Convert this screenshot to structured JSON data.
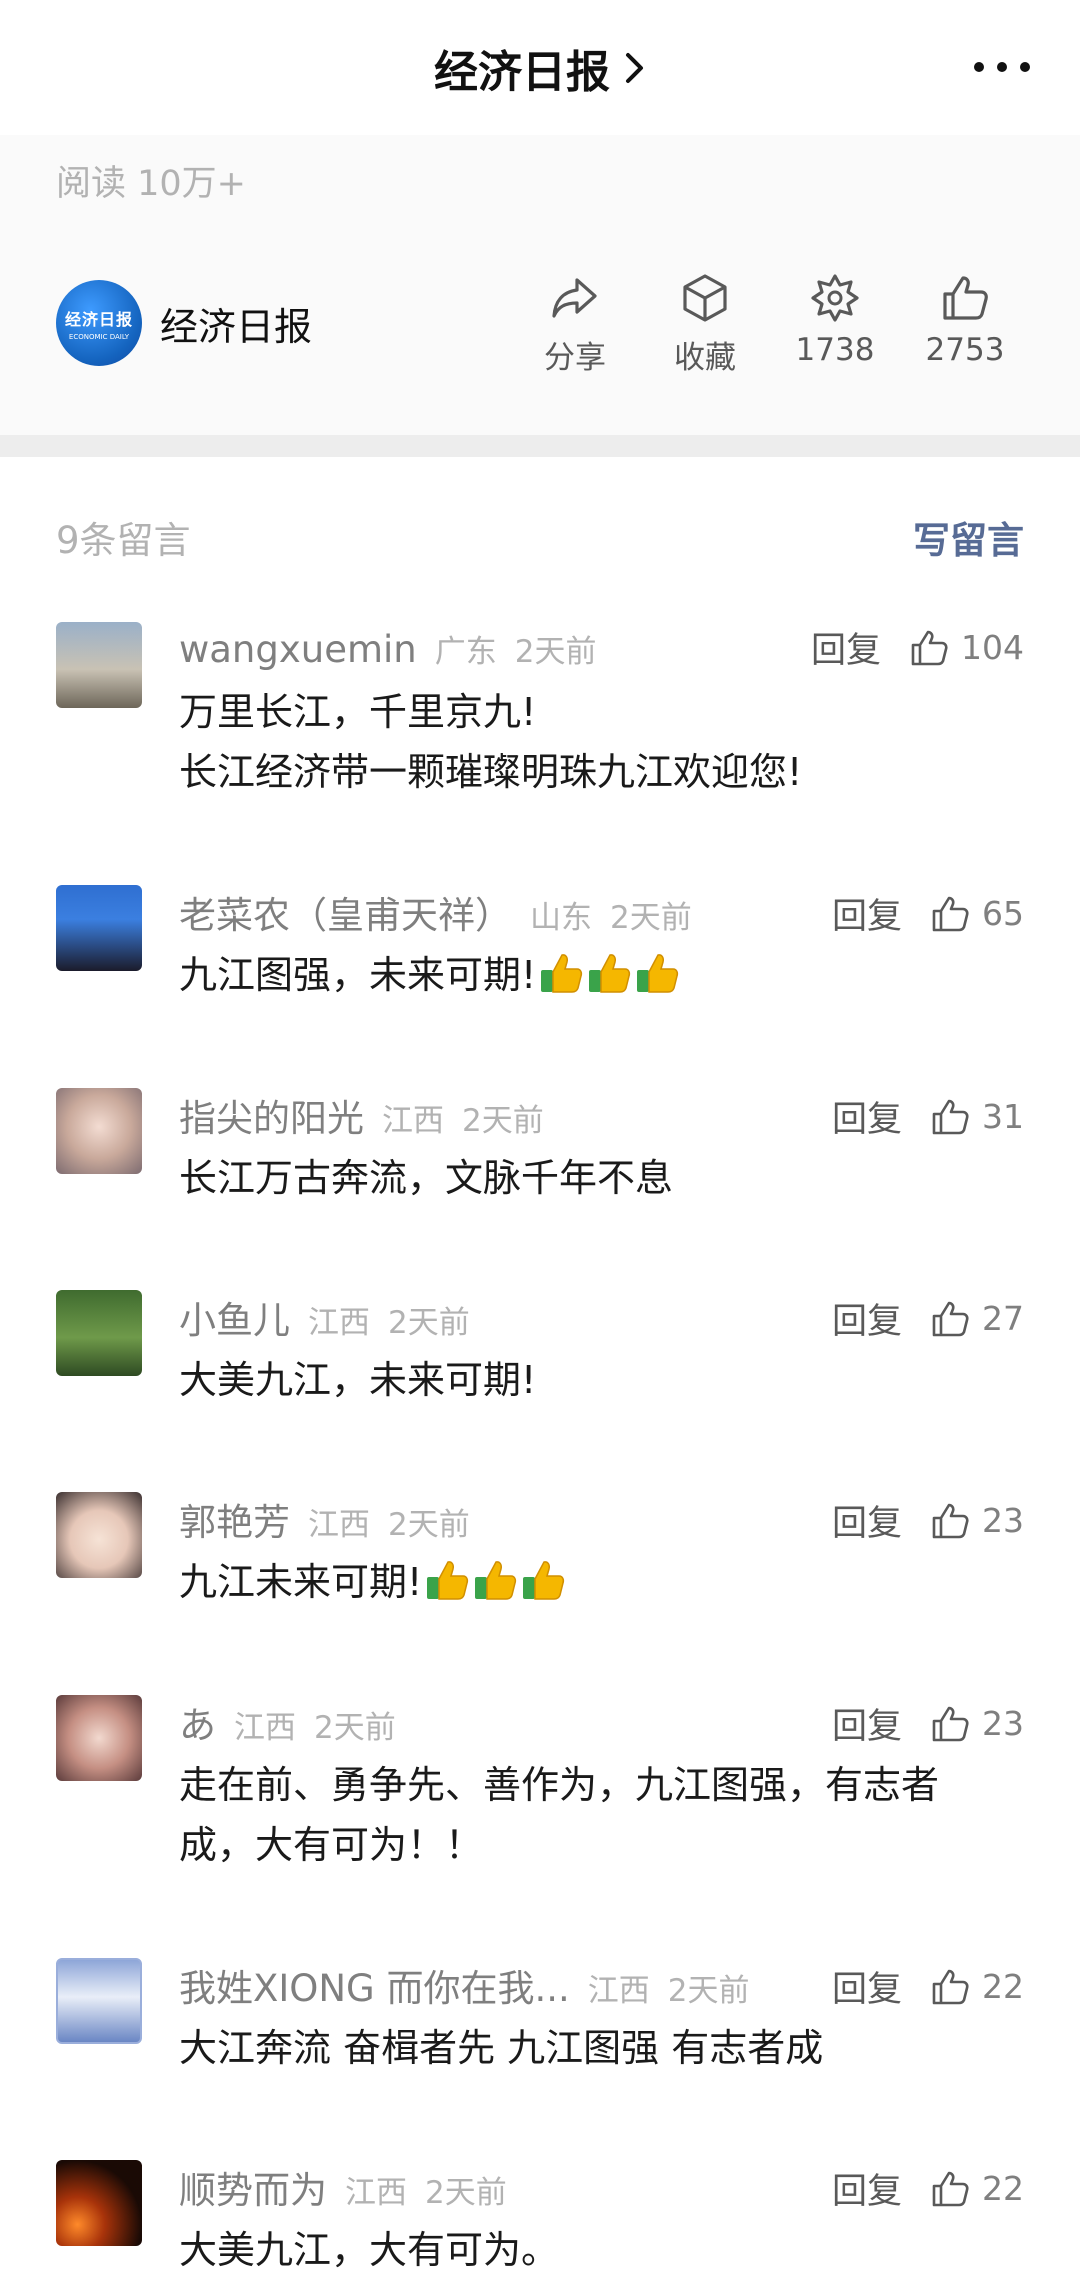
{
  "header": {
    "title": "经济日报"
  },
  "article": {
    "read_count": "阅读 10万+",
    "account_name": "经济日报",
    "logo_text": "经济日报",
    "logo_subtext": "ECONOMIC DAILY",
    "actions": [
      {
        "icon": "share-icon",
        "label": "分享"
      },
      {
        "icon": "favorite-box-icon",
        "label": "收藏"
      },
      {
        "icon": "wow-icon",
        "label": "1738"
      },
      {
        "icon": "like-icon",
        "label": "2753"
      }
    ]
  },
  "comments_header": {
    "count": "9条留言",
    "write": "写留言"
  },
  "comments": [
    {
      "nick": "wangxuemin",
      "region": "广东",
      "time": "2天前",
      "reply": "回复",
      "likes": "104",
      "text": "万里长江，千里京九!\n长江经济带一颗璀璨明珠九江欢迎您!",
      "thumbs": 0
    },
    {
      "nick": "老菜农（皇甫天祥）",
      "region": "山东",
      "time": "2天前",
      "reply": "回复",
      "likes": "65",
      "text": "九江图强，未来可期!",
      "thumbs": 3
    },
    {
      "nick": "指尖的阳光",
      "region": "江西",
      "time": "2天前",
      "reply": "回复",
      "likes": "31",
      "text": "长江万古奔流，文脉千年不息",
      "thumbs": 0
    },
    {
      "nick": "小鱼儿",
      "region": "江西",
      "time": "2天前",
      "reply": "回复",
      "likes": "27",
      "text": "大美九江，未来可期!",
      "thumbs": 0
    },
    {
      "nick": "郭艳芳",
      "region": "江西",
      "time": "2天前",
      "reply": "回复",
      "likes": "23",
      "text": "九江未来可期!",
      "thumbs": 3
    },
    {
      "nick": "あ",
      "region": "江西",
      "time": "2天前",
      "reply": "回复",
      "likes": "23",
      "text": "走在前、勇争先、善作为，九江图强，有志者\n成，大有可为！！",
      "thumbs": 0
    },
    {
      "nick": "我姓XIONG 而你在我...",
      "region": "江西",
      "time": "2天前",
      "reply": "回复",
      "likes": "22",
      "text": "大江奔流 奋楫者先 九江图强 有志者成",
      "thumbs": 0
    },
    {
      "nick": "顺势而为",
      "region": "江西",
      "time": "2天前",
      "reply": "回复",
      "likes": "22",
      "text": "大美九江，大有可为。",
      "thumbs": 0
    }
  ],
  "colors": {
    "link": "#576b95",
    "muted": "#b2b2b2",
    "divider": "#ededed"
  }
}
